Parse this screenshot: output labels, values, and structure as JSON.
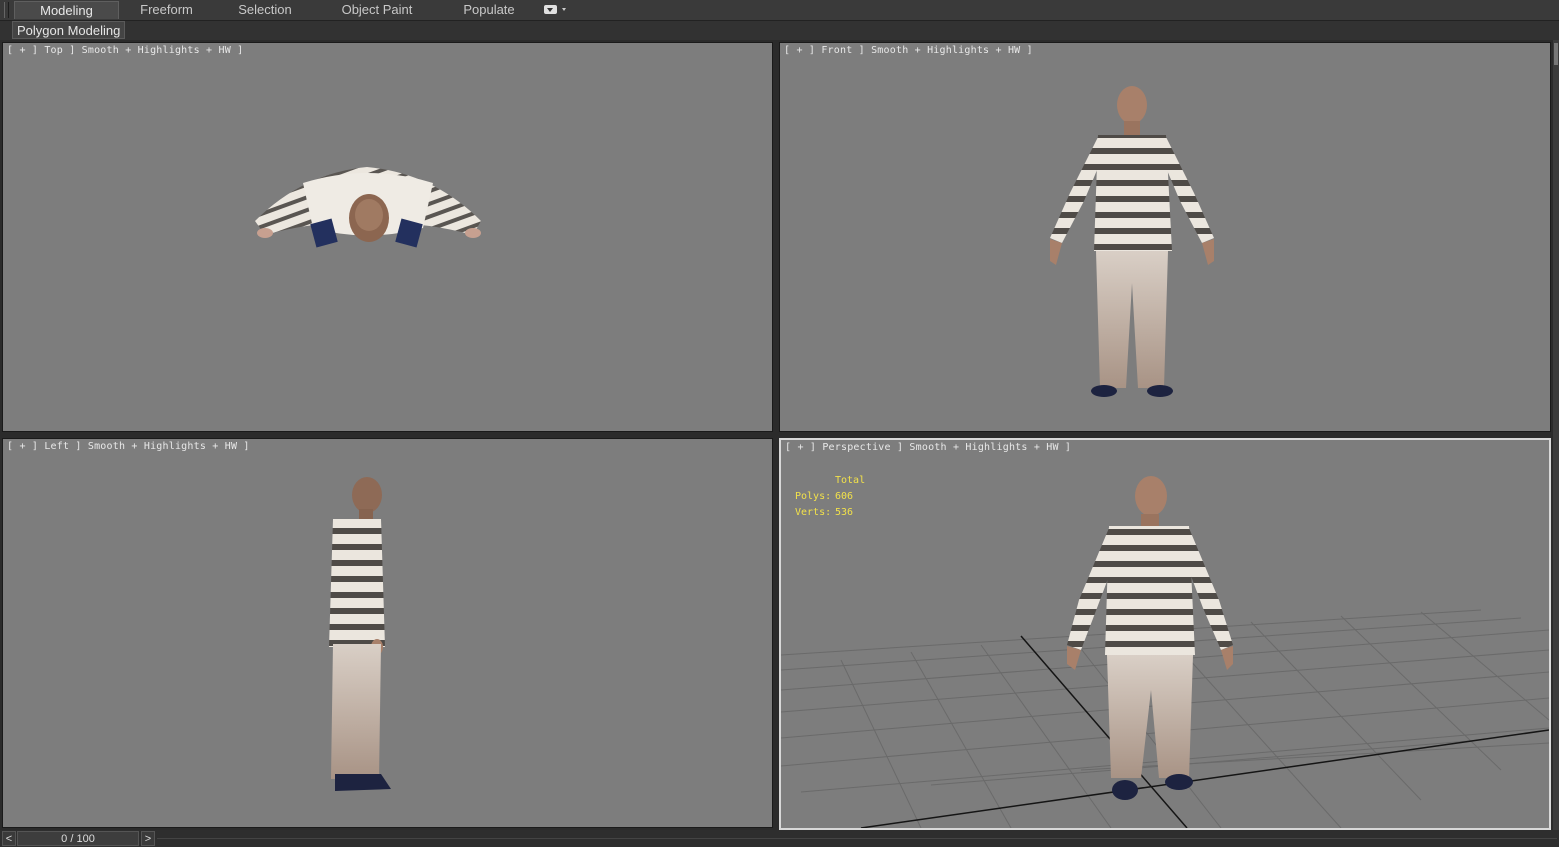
{
  "ribbon": {
    "tabs": [
      {
        "label": "Modeling",
        "active": true
      },
      {
        "label": "Freeform",
        "active": false
      },
      {
        "label": "Selection",
        "active": false
      },
      {
        "label": "Object Paint",
        "active": false
      },
      {
        "label": "Populate",
        "active": false
      }
    ],
    "dropdown_icon": "display-options-icon"
  },
  "panel": {
    "label": "Polygon Modeling"
  },
  "viewports": {
    "top": {
      "label": "[ + ] Top ] Smooth + Highlights + HW ]"
    },
    "front": {
      "label": "[ + ] Front ] Smooth + Highlights + HW ]"
    },
    "left": {
      "label": "[ + ] Left ] Smooth + Highlights + HW ]"
    },
    "perspective": {
      "label": "[ + ] Perspective ] Smooth + Highlights + HW ]"
    }
  },
  "stats": {
    "title": "Total",
    "polys_label": "Polys:",
    "polys_value": "606",
    "verts_label": "Verts:",
    "verts_value": "536"
  },
  "timeline": {
    "prev_label": "<",
    "next_label": ">",
    "frame_text": "0 / 100"
  },
  "colors": {
    "viewport_bg": "#7d7d7d",
    "active_border": "#d8d8d8",
    "stats_text": "#f2e14a"
  }
}
